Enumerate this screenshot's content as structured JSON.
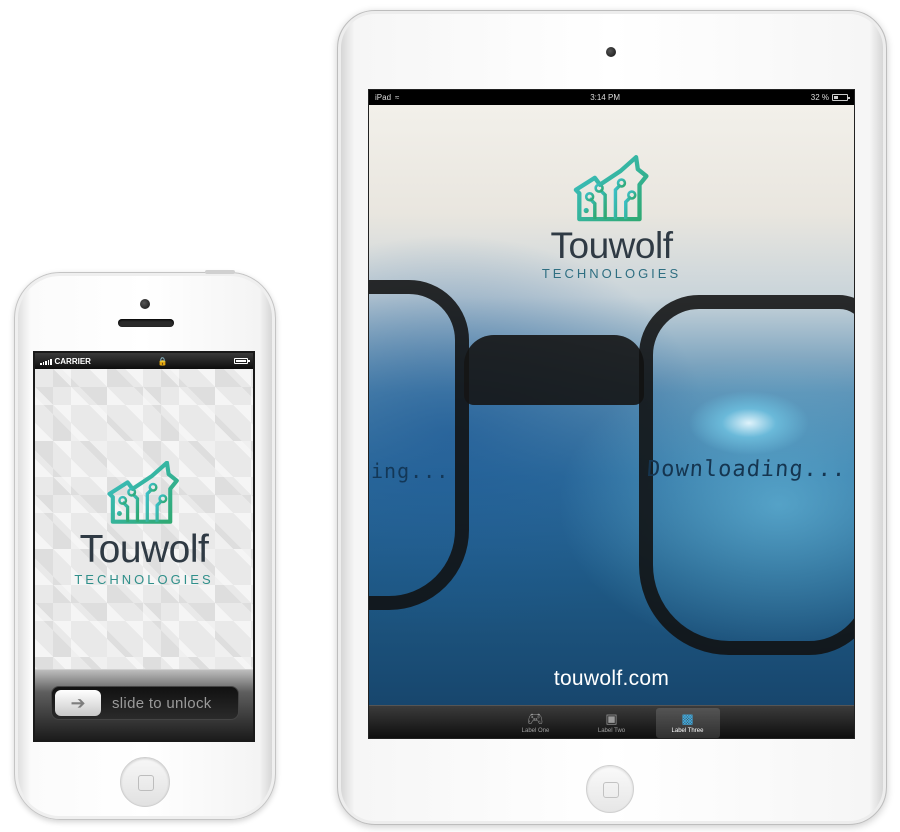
{
  "colors": {
    "logo_gradient_start": "#3cc0c9",
    "logo_gradient_end": "#2fa86f",
    "brand_text": "#2f3a44",
    "tab_active": "#3fb6f1"
  },
  "iphone": {
    "status": {
      "carrier": "CARRIER",
      "lock_icon": "lock-icon"
    },
    "brand": {
      "name": "Touwolf",
      "subtitle": "TECHNOLOGIES"
    },
    "unlock": {
      "text": "slide to unlock",
      "knob_icon": "arrow-right-icon"
    }
  },
  "ipad": {
    "status": {
      "device": "iPad",
      "time": "3:14 PM",
      "battery": "32 %"
    },
    "brand": {
      "name": "Touwolf",
      "subtitle": "TECHNOLOGIES"
    },
    "reflection_text": "Downloading...",
    "reflection_text_left": "ing...",
    "url": "touwolf.com",
    "tabs": [
      {
        "label": "Label One",
        "icon": "gamepad-icon",
        "active": false
      },
      {
        "label": "Label Two",
        "icon": "ipod-icon",
        "active": false
      },
      {
        "label": "Label Three",
        "icon": "monitor-icon",
        "active": true
      }
    ]
  }
}
